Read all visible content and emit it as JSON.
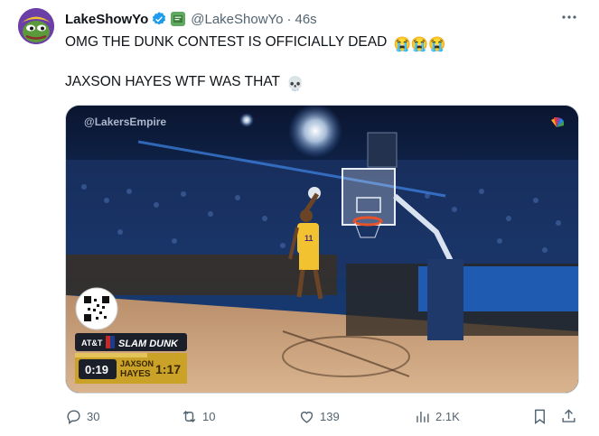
{
  "author": {
    "name": "LakeShowYo",
    "handle": "@LakeShowYo",
    "separator": "·",
    "time": "46s",
    "avatar_icon": "pepe-frog-avatar",
    "verified_icon": "verified-badge-icon",
    "affiliate_icon": "affiliate-badge-icon"
  },
  "tweet": {
    "line1": "OMG THE DUNK CONTEST IS OFFICIALLY DEAD",
    "line1_emoji": "😭😭😭",
    "line2": "JAXSON HAYES WTF WAS THAT",
    "line2_emoji": "💀"
  },
  "media": {
    "watermark": "@LakersEmpire",
    "scoreboard": {
      "sponsor": "AT&T",
      "event": "SLAM DUNK",
      "clock": "0:19",
      "player_first": "JAXSON",
      "player_last": "HAYES",
      "score": "1:17"
    },
    "jersey_number": "11",
    "broadcast_icon": "nbc-peacock-icon"
  },
  "actions": {
    "reply_count": "30",
    "retweet_count": "10",
    "like_count": "139",
    "views_count": "2.1K"
  },
  "colors": {
    "accent": "#1d9bf0",
    "muted": "#536471",
    "scoreboard_gold": "#c9a227"
  }
}
